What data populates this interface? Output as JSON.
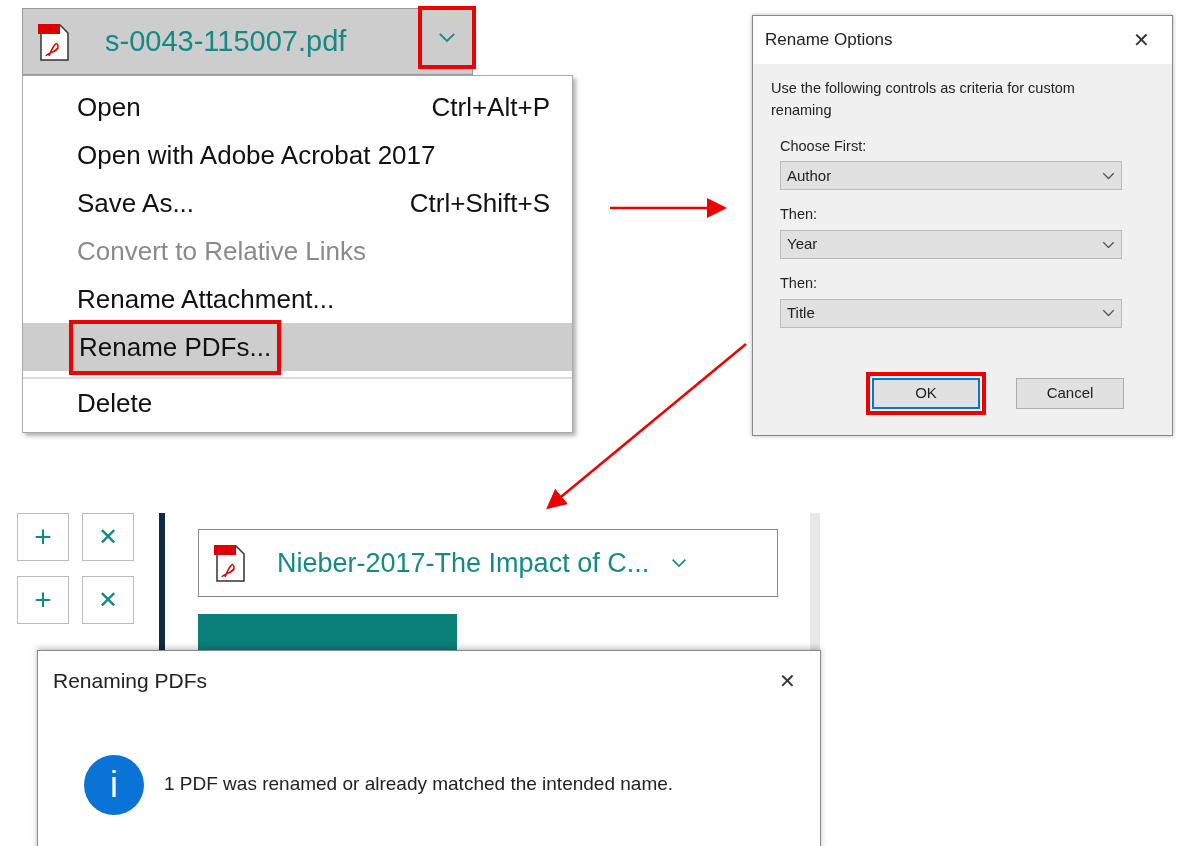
{
  "file_menu": {
    "file_name": "s-0043-115007.pdf",
    "dropdown_annotated": true,
    "items": [
      {
        "label": "Open",
        "shortcut": "Ctrl+Alt+P",
        "disabled": false,
        "selected": false,
        "annotated": false
      },
      {
        "label": "Open with Adobe Acrobat 2017",
        "disabled": false,
        "selected": false,
        "annotated": false
      },
      {
        "label": "Save As...",
        "shortcut": "Ctrl+Shift+S",
        "disabled": false,
        "selected": false,
        "annotated": false
      },
      {
        "label": "Convert to Relative Links",
        "disabled": true,
        "selected": false,
        "annotated": false
      },
      {
        "label": "Rename Attachment...",
        "disabled": false,
        "selected": false,
        "annotated": false
      },
      {
        "label": "Rename PDFs...",
        "disabled": false,
        "selected": true,
        "annotated": true
      },
      {
        "label": "Delete",
        "disabled": false,
        "selected": false,
        "annotated": false,
        "separator_before": true
      }
    ]
  },
  "rename_options": {
    "title": "Rename Options",
    "close": "✕",
    "instructions": "Use the following controls as criteria for custom renaming",
    "fields": [
      {
        "label": "Choose First:",
        "value": "Author"
      },
      {
        "label": "Then:",
        "value": "Year"
      },
      {
        "label": "Then:",
        "value": "Title"
      }
    ],
    "buttons": [
      {
        "label": "OK",
        "default": true,
        "annotated": true
      },
      {
        "label": "Cancel",
        "default": false,
        "annotated": false
      }
    ]
  },
  "attachments": {
    "side_buttons": [
      {
        "kind": "add",
        "symbol": "+"
      },
      {
        "kind": "remove",
        "symbol": "✕"
      },
      {
        "kind": "add",
        "symbol": "+"
      },
      {
        "kind": "remove",
        "symbol": "✕"
      }
    ],
    "file_name": "Nieber-2017-The Impact of C..."
  },
  "renaming_dialog": {
    "title": "Renaming PDFs",
    "close": "✕",
    "icon_letter": "i",
    "message": "1 PDF was renamed or already matched the intended name."
  }
}
